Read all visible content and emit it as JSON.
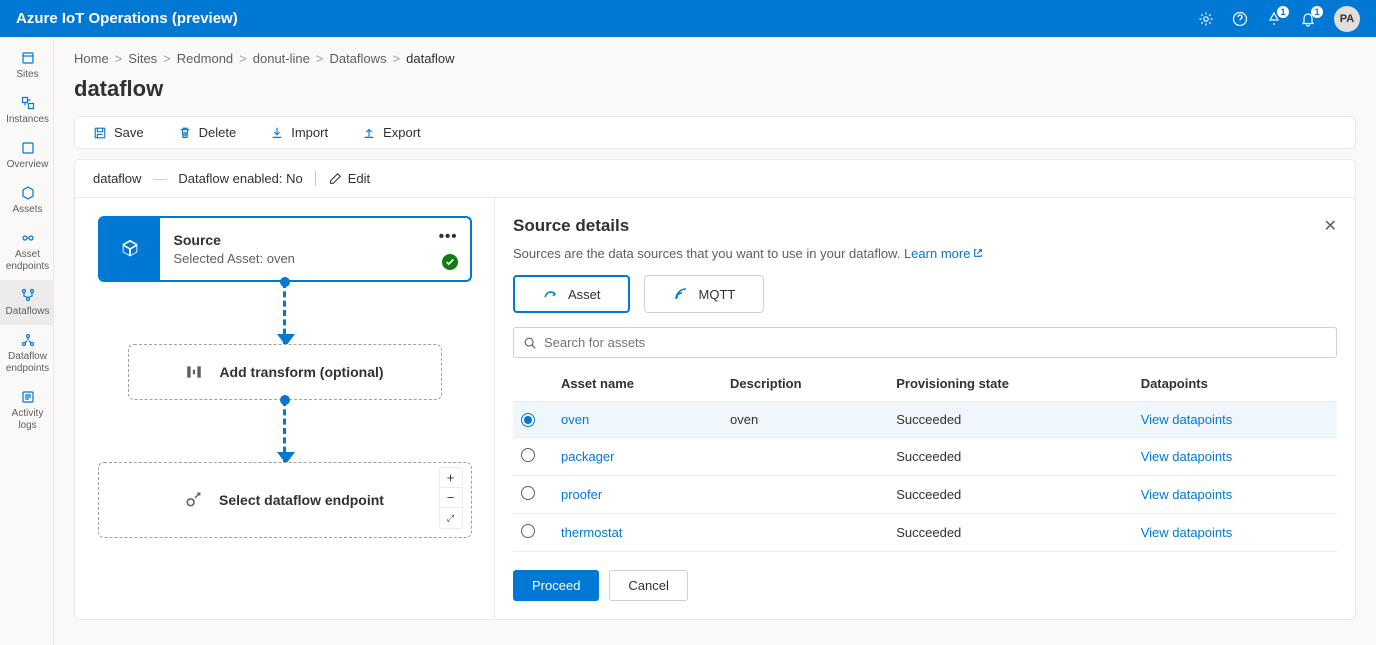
{
  "topbar": {
    "title": "Azure IoT Operations (preview)",
    "badge1": "1",
    "badge2": "1",
    "avatar": "PA"
  },
  "sidebar": {
    "items": [
      {
        "label": "Sites"
      },
      {
        "label": "Instances"
      },
      {
        "label": "Overview"
      },
      {
        "label": "Assets"
      },
      {
        "label": "Asset endpoints"
      },
      {
        "label": "Dataflows"
      },
      {
        "label": "Dataflow endpoints"
      },
      {
        "label": "Activity logs"
      }
    ]
  },
  "breadcrumb": {
    "items": [
      "Home",
      "Sites",
      "Redmond",
      "donut-line",
      "Dataflows"
    ],
    "current": "dataflow"
  },
  "page": {
    "title": "dataflow"
  },
  "toolbar": {
    "save": "Save",
    "delete": "Delete",
    "import": "Import",
    "export": "Export"
  },
  "status": {
    "name": "dataflow",
    "enabled": "Dataflow enabled: No",
    "edit": "Edit"
  },
  "canvas": {
    "source": {
      "title": "Source",
      "subtitle": "Selected Asset: oven"
    },
    "transform": {
      "title": "Add transform (optional)"
    },
    "endpoint": {
      "title": "Select dataflow endpoint"
    },
    "zoom": {
      "plus": "+",
      "minus": "−",
      "fit": "⤢"
    }
  },
  "details": {
    "title": "Source details",
    "desc": "Sources are the data sources that you want to use in your dataflow. ",
    "learn": "Learn more",
    "tab_asset": "Asset",
    "tab_mqtt": "MQTT",
    "search_placeholder": "Search for assets",
    "columns": {
      "name": "Asset name",
      "desc": "Description",
      "state": "Provisioning state",
      "dp": "Datapoints"
    },
    "rows": [
      {
        "name": "oven",
        "desc": "oven",
        "state": "Succeeded",
        "dp": "View datapoints",
        "selected": true
      },
      {
        "name": "packager",
        "desc": "",
        "state": "Succeeded",
        "dp": "View datapoints",
        "selected": false
      },
      {
        "name": "proofer",
        "desc": "",
        "state": "Succeeded",
        "dp": "View datapoints",
        "selected": false
      },
      {
        "name": "thermostat",
        "desc": "",
        "state": "Succeeded",
        "dp": "View datapoints",
        "selected": false
      }
    ],
    "proceed": "Proceed",
    "cancel": "Cancel"
  }
}
